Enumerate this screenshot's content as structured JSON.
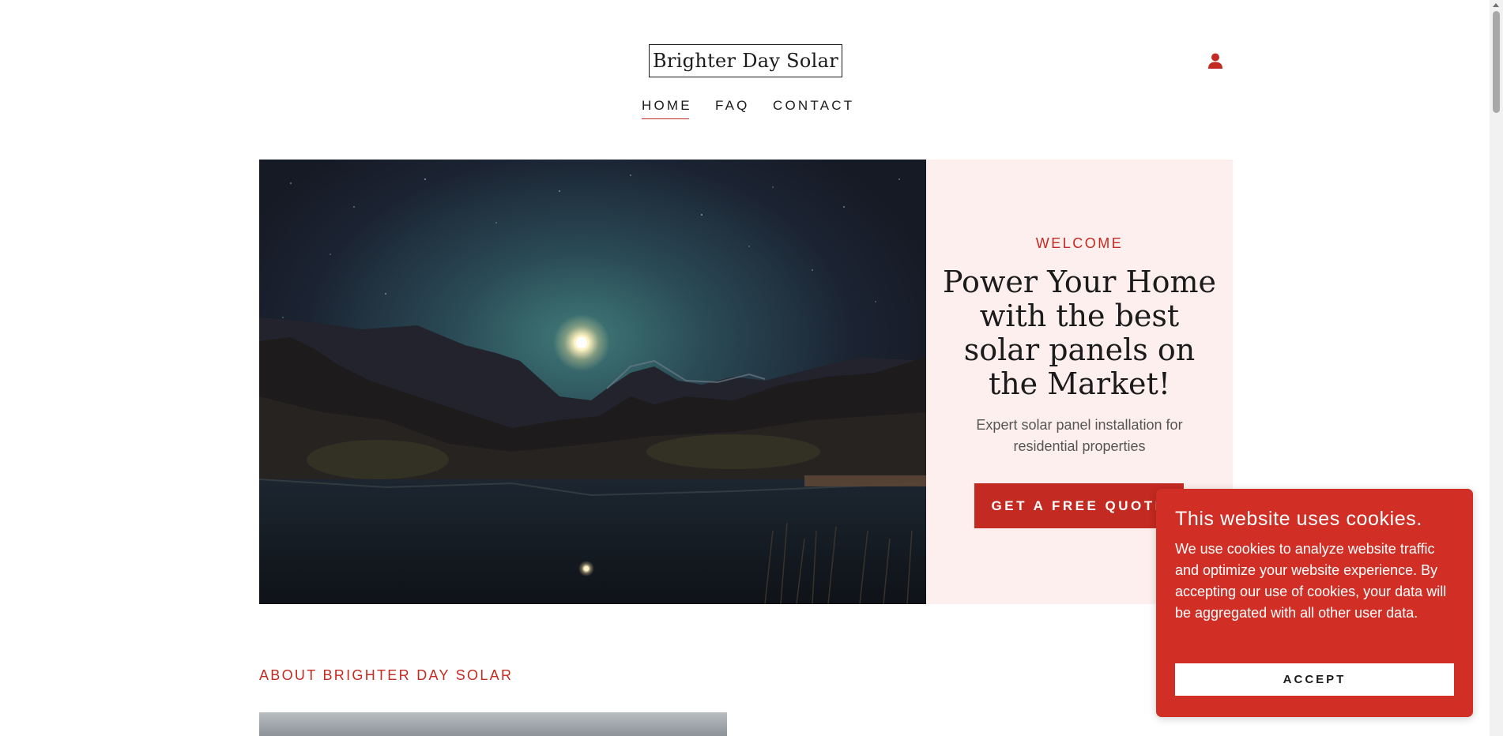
{
  "header": {
    "logo": "Brighter Day Solar",
    "account_icon": "user-icon"
  },
  "nav": {
    "items": [
      {
        "label": "HOME",
        "active": true
      },
      {
        "label": "FAQ",
        "active": false
      },
      {
        "label": "CONTACT",
        "active": false
      }
    ]
  },
  "hero": {
    "kicker": "WELCOME",
    "title": "Power Your Home with the best solar panels on the Market!",
    "subtitle": "Expert solar panel installation for residential properties",
    "cta": "GET A FREE QUOTE"
  },
  "about": {
    "heading": "ABOUT BRIGHTER DAY SOLAR"
  },
  "cookie": {
    "title": "This website uses cookies.",
    "body": "We use cookies to analyze website traffic and optimize your website experience. By accepting our use of cookies, your data will be aggregated with all other user data.",
    "accept": "ACCEPT"
  },
  "colors": {
    "accent": "#c32a21",
    "hero_panel_bg": "#fdefed",
    "cookie_bg": "#d12f25"
  }
}
